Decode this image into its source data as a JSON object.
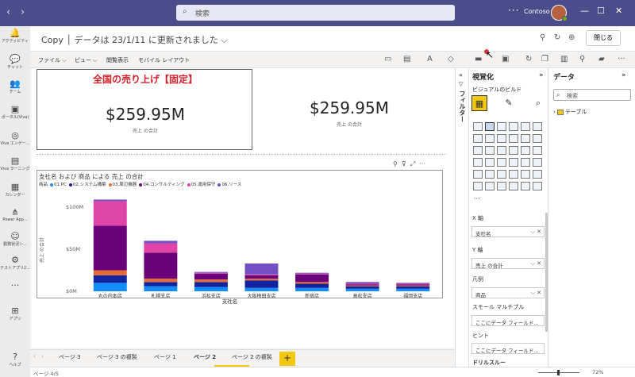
{
  "titlebar": {
    "search_placeholder": "検索",
    "org": "Contoso",
    "more": "···"
  },
  "rail": [
    {
      "icon": "bell-icon",
      "glyph": "🔔",
      "label": "アクティビティ"
    },
    {
      "icon": "chat-icon",
      "glyph": "💬",
      "label": "チャット"
    },
    {
      "icon": "teams-icon",
      "glyph": "👥",
      "label": "チーム"
    },
    {
      "icon": "viva-portal-icon",
      "glyph": "▣",
      "label": "ポータル(Viva)"
    },
    {
      "icon": "viva-engage-icon",
      "glyph": "◎",
      "label": "Viva エンゲー..."
    },
    {
      "icon": "viva-learning-icon",
      "glyph": "▤",
      "label": "Viva ラーニング"
    },
    {
      "icon": "calendar-icon",
      "glyph": "▦",
      "label": "カレンダー"
    },
    {
      "icon": "power-apps-icon",
      "glyph": "⋔",
      "label": "Power App..."
    },
    {
      "icon": "status-icon",
      "glyph": "☺",
      "label": "勤務状況シ..."
    },
    {
      "icon": "test-app-icon",
      "glyph": "⚙",
      "label": "テストアプリ2..."
    },
    {
      "icon": "more-icon",
      "glyph": "···",
      "label": ""
    },
    {
      "icon": "apps-icon",
      "glyph": "⊞",
      "label": "アプリ"
    },
    {
      "icon": "help-icon",
      "glyph": "?",
      "label": "ヘルプ"
    }
  ],
  "apphead": {
    "title": "Copy │ データは 23/1/11 に更新されました ⌵",
    "close": "閉じる"
  },
  "toolbar": {
    "file": "ファイル ⌵",
    "view": "ビュー ⌵",
    "read": "閲覧表示",
    "mobile": "モバイル レイアウト"
  },
  "card1": {
    "title": "全国の売り上げ【固定】",
    "value": "$259.95M",
    "label": "売上 の合計"
  },
  "card2": {
    "value": "$259.95M",
    "label": "売上 の合計"
  },
  "chart_data": {
    "type": "bar",
    "stacked": true,
    "title": "支社名 および 商品 による 売上 の合計",
    "legend_title": "商品",
    "xlabel": "支社名",
    "ylabel": "売上 の合計",
    "ylim": [
      0,
      100
    ],
    "yticks": [
      "$0M",
      "$50M",
      "$100M"
    ],
    "categories": [
      "丸の内本店",
      "札幌支店",
      "浜松支店",
      "大阪梅田支店",
      "新宿店",
      "高松支店",
      "福岡支店"
    ],
    "series": [
      {
        "name": "01.PC",
        "color": "#118dff",
        "values": [
          10,
          6,
          5,
          4,
          4,
          3,
          3
        ]
      },
      {
        "name": "02.システム構築",
        "color": "#12239e",
        "values": [
          9,
          5,
          6,
          9,
          5,
          3,
          3
        ]
      },
      {
        "name": "03.周辺機器",
        "color": "#e66c37",
        "values": [
          6,
          4,
          3,
          2,
          2,
          1,
          1
        ]
      },
      {
        "name": "04.コンサルティング",
        "color": "#6b007b",
        "values": [
          53,
          31,
          7,
          4,
          9,
          1,
          1
        ]
      },
      {
        "name": "05.運用保守",
        "color": "#e044a7",
        "values": [
          29,
          11,
          1,
          1,
          1,
          1,
          1
        ]
      },
      {
        "name": "06.リース",
        "color": "#744ec2",
        "values": [
          2,
          3,
          1,
          13,
          1,
          2,
          1
        ]
      }
    ]
  },
  "tabs": [
    "ページ 3",
    "ページ 3 の複製",
    "ページ 1",
    "ページ 2",
    "ページ 2 の複製",
    "+"
  ],
  "status": {
    "page": "ページ 4/5",
    "zoom": "72%"
  },
  "filters": {
    "label": "フィルター"
  },
  "viz": {
    "title": "視覚化",
    "subtitle": "ビジュアルのビルド",
    "x_label": "X 軸",
    "x_value": "支社名",
    "y_label": "Y 軸",
    "y_value": "売上 の合計",
    "legend_label": "凡例",
    "legend_value": "商品",
    "small_label": "スモール マルチプル",
    "small_value": "ここにデータ フィールド...",
    "tooltip_label": "ヒント",
    "tooltip_value": "ここにデータ フィールド...",
    "drill_label": "ドリルスルー"
  },
  "data": {
    "title": "データ",
    "search": "検索",
    "table": "テーブル"
  }
}
